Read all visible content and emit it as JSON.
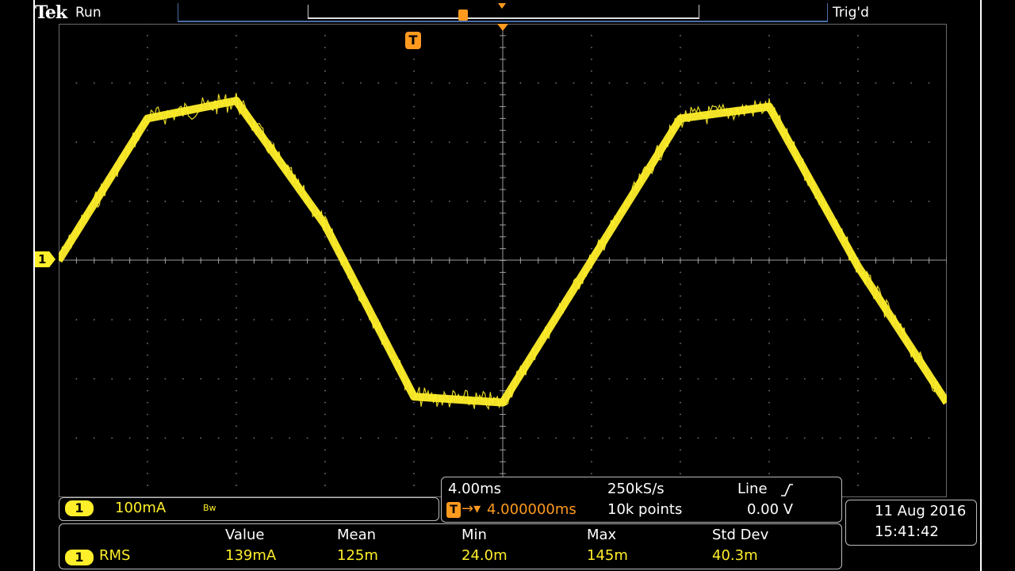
{
  "brand": "Tek",
  "acq_state": "Run",
  "trigger_status": "Trig'd",
  "ch1_marker": "1",
  "trigger_marker": "T",
  "channel_panel": {
    "channel": "1",
    "scale": "100mA",
    "bw_indicator": "Bw"
  },
  "timebase_panel": {
    "time_per_div": "4.00ms",
    "sample_rate": "250kS/s",
    "trigger_source": "Line",
    "trigger_slope_icon": "rising-edge-icon",
    "trigger_delay": "4.000000ms",
    "record_length": "10k points",
    "trigger_level": "0.00 V"
  },
  "datetime": {
    "date": "11 Aug 2016",
    "time": "15:41:42"
  },
  "measurements": {
    "headers": [
      "Value",
      "Mean",
      "Min",
      "Max",
      "Std Dev"
    ],
    "row": {
      "channel": "1",
      "type": "RMS",
      "values": [
        "139mA",
        "125m",
        "24.0m",
        "145m",
        "40.3m"
      ]
    }
  },
  "colors": {
    "trace": "#ffef2a",
    "trigger": "#ff9a1f",
    "frame": "#4a6ea8",
    "background": "#000000"
  },
  "chart_data": {
    "type": "line",
    "xlabel": "",
    "ylabel": "",
    "x_divisions": 10,
    "y_divisions": 8,
    "series": [
      {
        "x": [
          0,
          4,
          8,
          12,
          16,
          20,
          24,
          28,
          32,
          36,
          40
        ],
        "values": [
          0,
          240,
          270,
          60,
          -230,
          -240,
          0,
          240,
          260,
          -10,
          -240
        ]
      }
    ]
  }
}
